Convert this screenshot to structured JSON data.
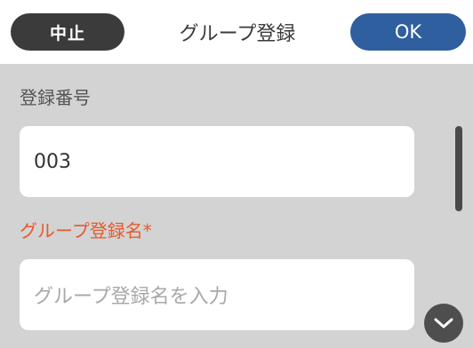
{
  "header": {
    "cancel_label": "中止",
    "title": "グループ登録",
    "ok_label": "OK"
  },
  "form": {
    "number_label": "登録番号",
    "number_value": "003",
    "name_label": "グループ登録名*",
    "name_placeholder": "グループ登録名を入力"
  },
  "colors": {
    "required_label": "#e45a2e",
    "ok_button": "#2f5f9e",
    "cancel_button": "#3b3b3b"
  },
  "icons": {
    "scroll_down": "chevron-down-icon"
  }
}
